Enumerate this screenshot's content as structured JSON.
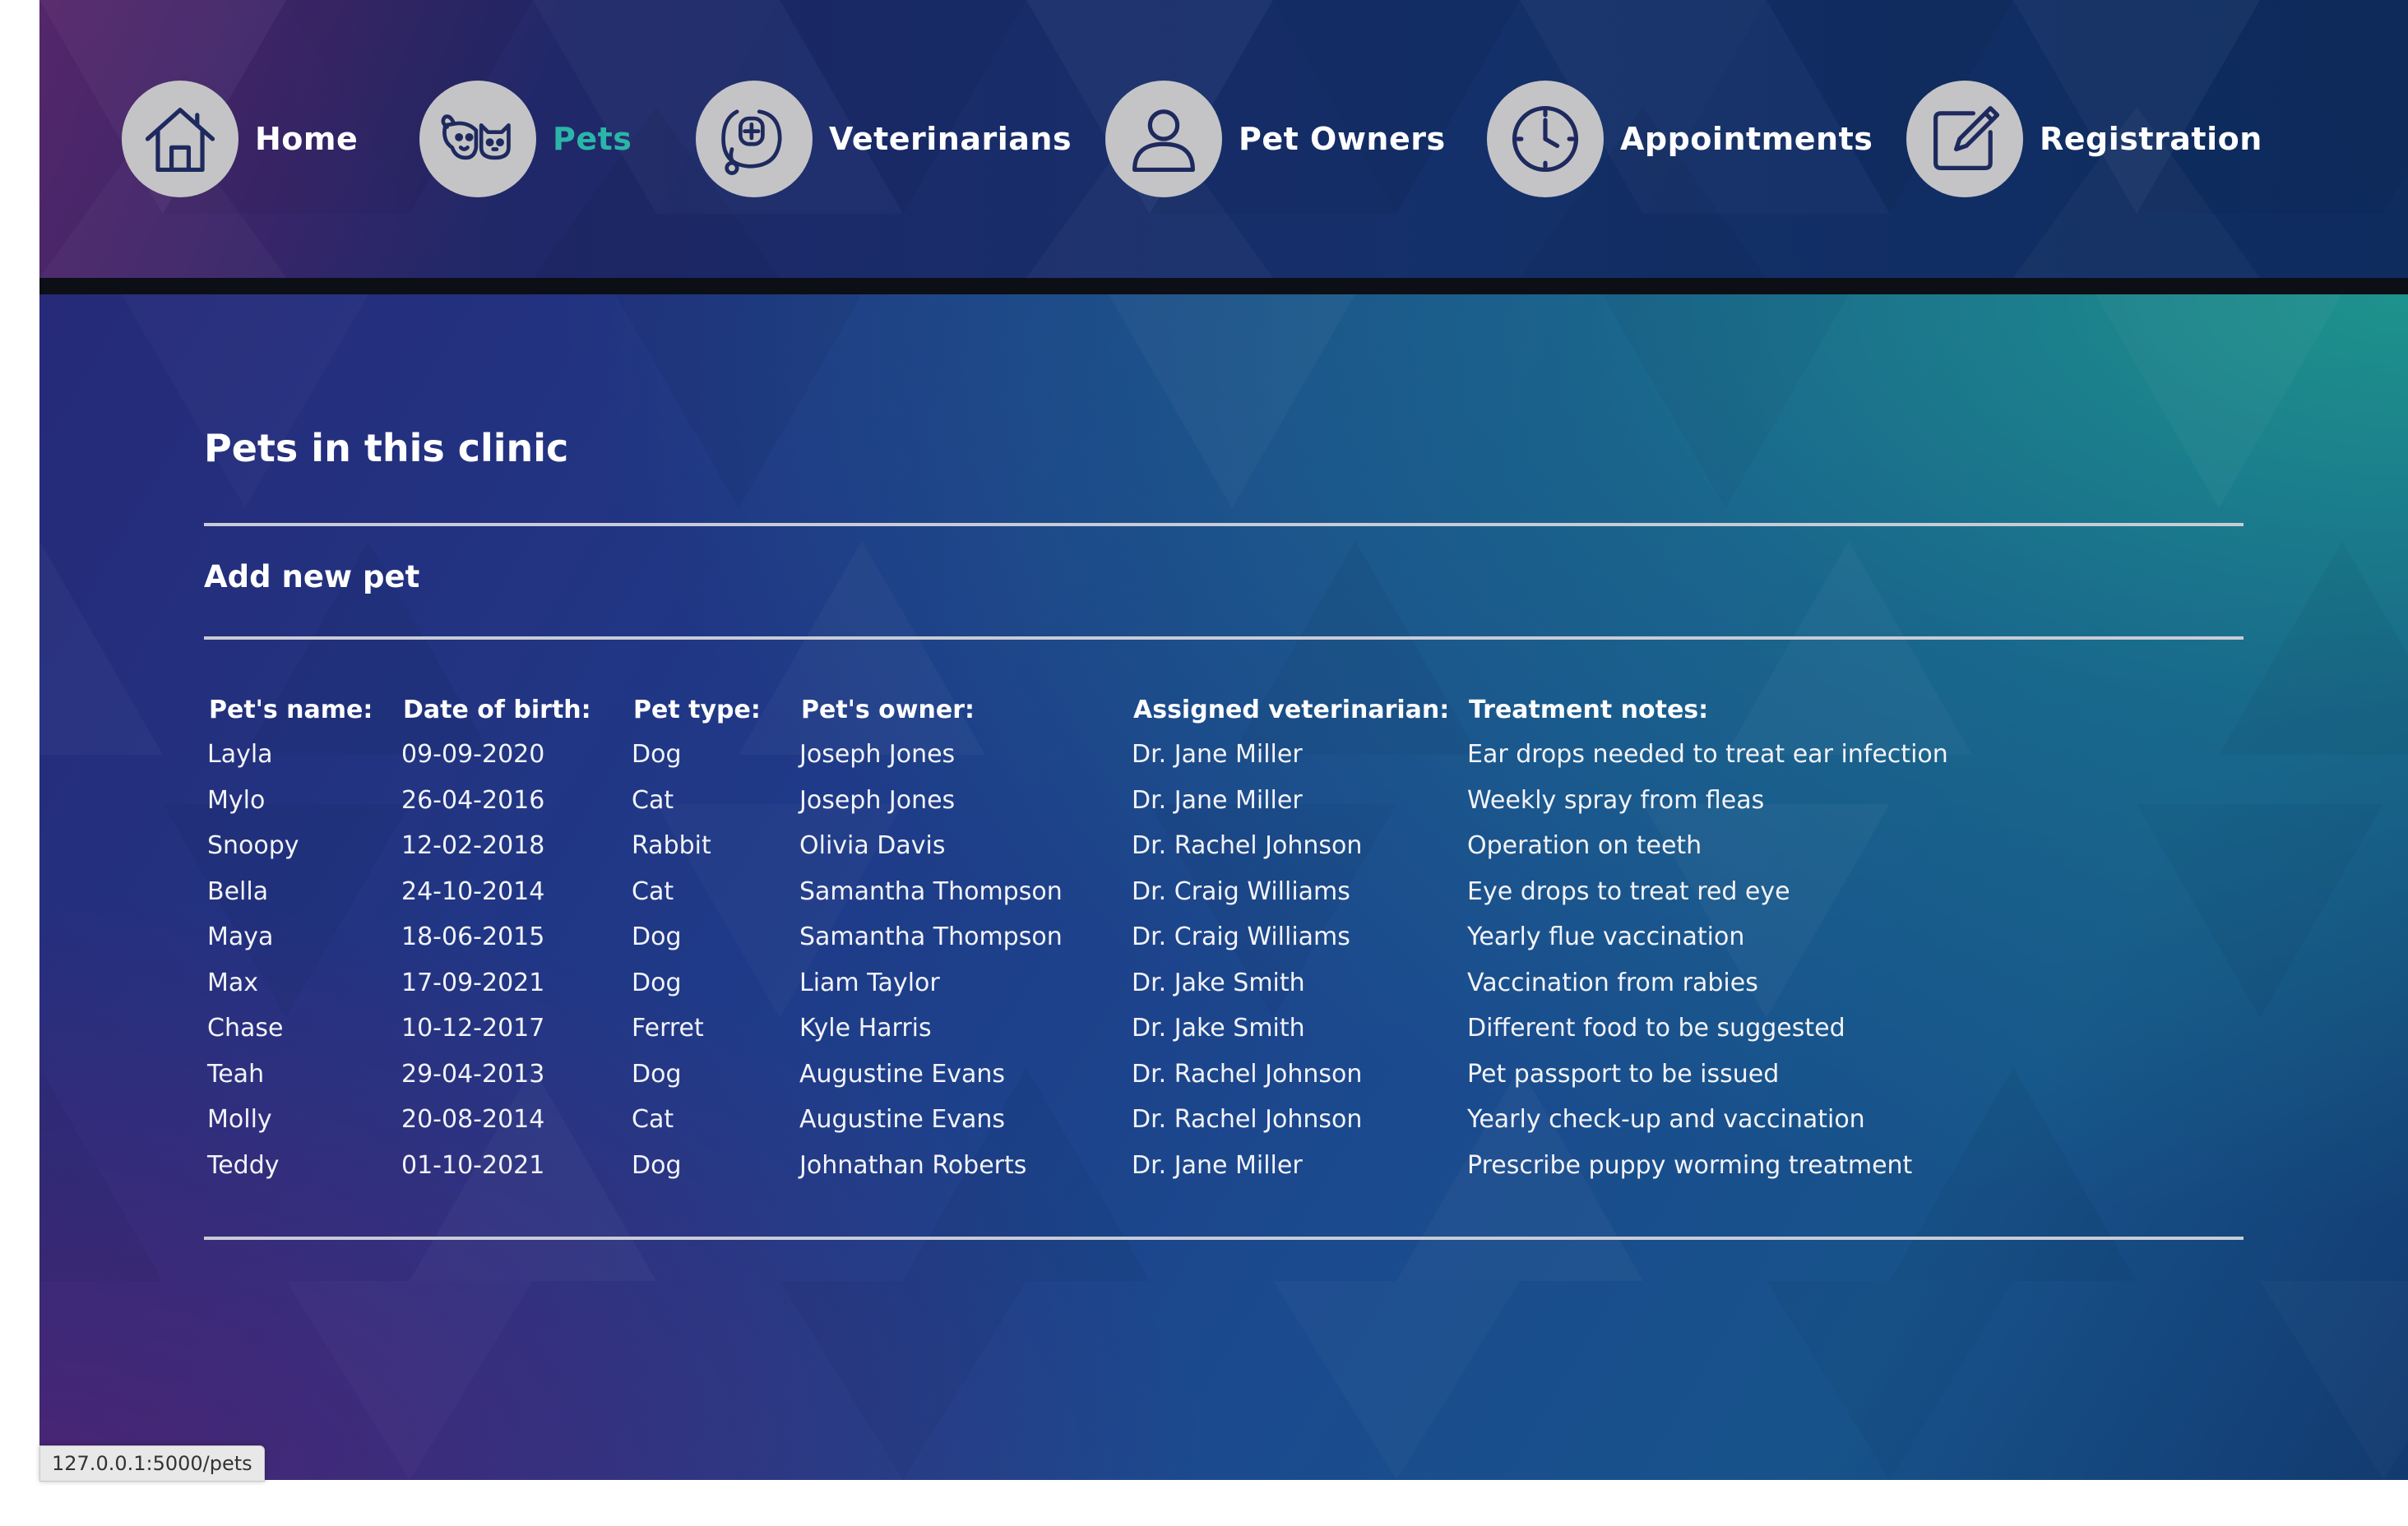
{
  "nav": {
    "items": [
      {
        "label": "Home",
        "icon": "home-icon",
        "active": false
      },
      {
        "label": "Pets",
        "icon": "pets-icon",
        "active": true
      },
      {
        "label": "Veterinarians",
        "icon": "stethoscope-icon",
        "active": false
      },
      {
        "label": "Pet Owners",
        "icon": "person-icon",
        "active": false
      },
      {
        "label": "Appointments",
        "icon": "clock-icon",
        "active": false
      },
      {
        "label": "Registration",
        "icon": "edit-icon",
        "active": false
      }
    ]
  },
  "page": {
    "title": "Pets in this clinic",
    "add_link": "Add new pet"
  },
  "table": {
    "headers": [
      "Pet's name:",
      "Date of birth:",
      "Pet type:",
      "Pet's owner:",
      "Assigned veterinarian:",
      "Treatment notes:"
    ],
    "rows": [
      [
        "Layla",
        "09-09-2020",
        "Dog",
        "Joseph Jones",
        "Dr. Jane Miller",
        "Ear drops needed to treat ear infection"
      ],
      [
        "Mylo",
        "26-04-2016",
        "Cat",
        "Joseph Jones",
        "Dr. Jane Miller",
        "Weekly spray from fleas"
      ],
      [
        "Snoopy",
        "12-02-2018",
        "Rabbit",
        "Olivia Davis",
        "Dr. Rachel Johnson",
        "Operation on teeth"
      ],
      [
        "Bella",
        "24-10-2014",
        "Cat",
        "Samantha Thompson",
        "Dr. Craig Williams",
        "Eye drops to treat red eye"
      ],
      [
        "Maya",
        "18-06-2015",
        "Dog",
        "Samantha Thompson",
        "Dr. Craig Williams",
        "Yearly flue vaccination"
      ],
      [
        "Max",
        "17-09-2021",
        "Dog",
        "Liam Taylor",
        "Dr. Jake Smith",
        "Vaccination from rabies"
      ],
      [
        "Chase",
        "10-12-2017",
        "Ferret",
        "Kyle Harris",
        "Dr. Jake Smith",
        "Different food to be suggested"
      ],
      [
        "Teah",
        "29-04-2013",
        "Dog",
        "Augustine Evans",
        "Dr. Rachel Johnson",
        "Pet passport to be issued"
      ],
      [
        "Molly",
        "20-08-2014",
        "Cat",
        "Augustine Evans",
        "Dr. Rachel Johnson",
        "Yearly check-up and vaccination"
      ],
      [
        "Teddy",
        "01-10-2021",
        "Dog",
        "Johnathan Roberts",
        "Dr. Jane Miller",
        "Prescribe puppy worming treatment"
      ]
    ]
  },
  "status_bar": {
    "url": "127.0.0.1:5000/pets"
  },
  "colors": {
    "active_nav": "#2bb5a8",
    "icon_circle": "#c4c4c6",
    "icon_stroke": "#1e2a5e",
    "rule": "#c9ccd6"
  }
}
